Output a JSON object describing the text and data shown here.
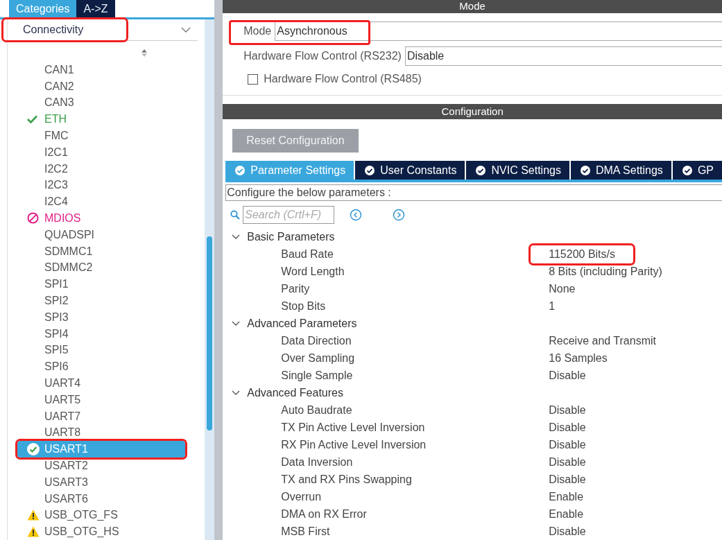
{
  "sidebar": {
    "tabs": [
      {
        "label": "Categories",
        "selected": true
      },
      {
        "label": "A->Z",
        "selected": false
      }
    ],
    "category": {
      "label": "Connectivity",
      "highlighted": true
    },
    "items": [
      {
        "label": "CAN1",
        "kind": "none",
        "selected": false,
        "highlighted": false
      },
      {
        "label": "CAN2",
        "kind": "none",
        "selected": false,
        "highlighted": false
      },
      {
        "label": "CAN3",
        "kind": "none",
        "selected": false,
        "highlighted": false
      },
      {
        "label": "ETH",
        "kind": "ok",
        "selected": false,
        "highlighted": false
      },
      {
        "label": "FMC",
        "kind": "none",
        "selected": false,
        "highlighted": false
      },
      {
        "label": "I2C1",
        "kind": "none",
        "selected": false,
        "highlighted": false
      },
      {
        "label": "I2C2",
        "kind": "none",
        "selected": false,
        "highlighted": false
      },
      {
        "label": "I2C3",
        "kind": "none",
        "selected": false,
        "highlighted": false
      },
      {
        "label": "I2C4",
        "kind": "none",
        "selected": false,
        "highlighted": false
      },
      {
        "label": "MDIOS",
        "kind": "error",
        "selected": false,
        "highlighted": false
      },
      {
        "label": "QUADSPI",
        "kind": "none",
        "selected": false,
        "highlighted": false
      },
      {
        "label": "SDMMC1",
        "kind": "none",
        "selected": false,
        "highlighted": false
      },
      {
        "label": "SDMMC2",
        "kind": "none",
        "selected": false,
        "highlighted": false
      },
      {
        "label": "SPI1",
        "kind": "none",
        "selected": false,
        "highlighted": false
      },
      {
        "label": "SPI2",
        "kind": "none",
        "selected": false,
        "highlighted": false
      },
      {
        "label": "SPI3",
        "kind": "none",
        "selected": false,
        "highlighted": false
      },
      {
        "label": "SPI4",
        "kind": "none",
        "selected": false,
        "highlighted": false
      },
      {
        "label": "SPI5",
        "kind": "none",
        "selected": false,
        "highlighted": false
      },
      {
        "label": "SPI6",
        "kind": "none",
        "selected": false,
        "highlighted": false
      },
      {
        "label": "UART4",
        "kind": "none",
        "selected": false,
        "highlighted": false
      },
      {
        "label": "UART5",
        "kind": "none",
        "selected": false,
        "highlighted": false
      },
      {
        "label": "UART7",
        "kind": "none",
        "selected": false,
        "highlighted": false
      },
      {
        "label": "UART8",
        "kind": "none",
        "selected": false,
        "highlighted": false
      },
      {
        "label": "USART1",
        "kind": "ok",
        "selected": true,
        "highlighted": true
      },
      {
        "label": "USART2",
        "kind": "none",
        "selected": false,
        "highlighted": false
      },
      {
        "label": "USART3",
        "kind": "none",
        "selected": false,
        "highlighted": false
      },
      {
        "label": "USART6",
        "kind": "none",
        "selected": false,
        "highlighted": false
      },
      {
        "label": "USB_OTG_FS",
        "kind": "warning",
        "selected": false,
        "highlighted": false
      },
      {
        "label": "USB_OTG_HS",
        "kind": "warning",
        "selected": false,
        "highlighted": false
      }
    ]
  },
  "mode": {
    "title": "Mode",
    "mode_field": {
      "label": "Mode",
      "value": "Asynchronous",
      "highlighted": true
    },
    "flow_rs232": {
      "label": "Hardware Flow Control (RS232)",
      "value": "Disable"
    },
    "flow_rs485": {
      "label": "Hardware Flow Control (RS485)",
      "checked": false
    }
  },
  "configuration": {
    "title": "Configuration",
    "reset_button": "Reset Configuration",
    "tabs": [
      {
        "label": "Parameter Settings",
        "selected": true
      },
      {
        "label": "User Constants",
        "selected": false
      },
      {
        "label": "NVIC Settings",
        "selected": false
      },
      {
        "label": "DMA Settings",
        "selected": false
      },
      {
        "label": "GP",
        "selected": false
      }
    ],
    "hint": "Configure the below parameters :",
    "search": {
      "placeholder": "Search (Crtl+F)"
    },
    "groups": [
      {
        "name": "Basic Parameters",
        "expanded": true,
        "children": [
          {
            "name": "Baud Rate",
            "value": "115200 Bits/s",
            "highlighted": true
          },
          {
            "name": "Word Length",
            "value": "8 Bits (including Parity)",
            "highlighted": false
          },
          {
            "name": "Parity",
            "value": "None",
            "highlighted": false
          },
          {
            "name": "Stop Bits",
            "value": "1",
            "highlighted": false
          }
        ]
      },
      {
        "name": "Advanced Parameters",
        "expanded": true,
        "children": [
          {
            "name": "Data Direction",
            "value": "Receive and Transmit",
            "highlighted": false
          },
          {
            "name": "Over Sampling",
            "value": "16 Samples",
            "highlighted": false
          },
          {
            "name": "Single Sample",
            "value": "Disable",
            "highlighted": false
          }
        ]
      },
      {
        "name": "Advanced Features",
        "expanded": true,
        "children": [
          {
            "name": "Auto Baudrate",
            "value": "Disable",
            "highlighted": false
          },
          {
            "name": "TX Pin Active Level Inversion",
            "value": "Disable",
            "highlighted": false
          },
          {
            "name": "RX Pin Active Level Inversion",
            "value": "Disable",
            "highlighted": false
          },
          {
            "name": "Data Inversion",
            "value": "Disable",
            "highlighted": false
          },
          {
            "name": "TX and RX Pins Swapping",
            "value": "Disable",
            "highlighted": false
          },
          {
            "name": "Overrun",
            "value": "Enable",
            "highlighted": false
          },
          {
            "name": "DMA on RX Error",
            "value": "Enable",
            "highlighted": false
          },
          {
            "name": "MSB First",
            "value": "Disable",
            "highlighted": false
          }
        ]
      }
    ]
  }
}
